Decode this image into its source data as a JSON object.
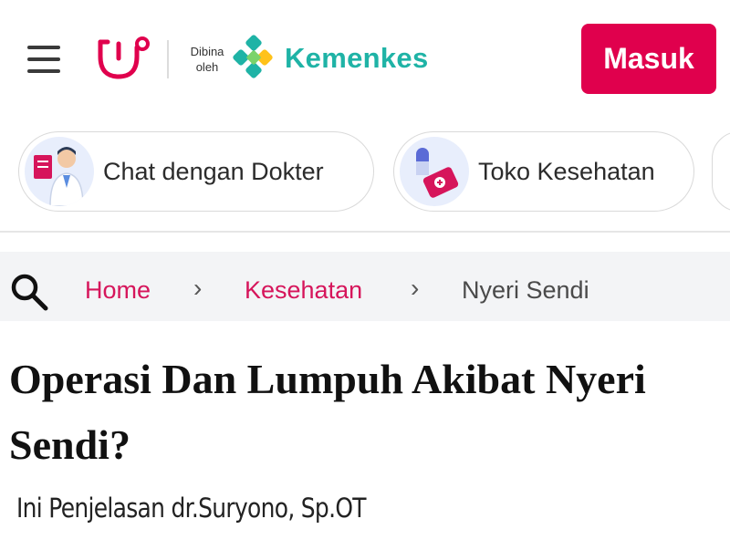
{
  "header": {
    "menu_icon": "hamburger-menu-icon",
    "brand_icon": "stethoscope-logo-icon",
    "partner_prefix_line1": "Dibina",
    "partner_prefix_line2": "oleh",
    "partner_name": "Kemenkes",
    "partner_icon": "kemenkes-logo-icon",
    "login_label": "Masuk",
    "colors": {
      "brand": "#e0004d",
      "partner": "#1fb3a6"
    }
  },
  "quick_actions": [
    {
      "label": "Chat dengan Dokter",
      "icon": "doctor-chat-icon"
    },
    {
      "label": "Toko Kesehatan",
      "icon": "pharmacy-store-icon"
    },
    {
      "label": "",
      "icon": "more-action-icon"
    }
  ],
  "breadcrumb": {
    "search_icon": "search-icon",
    "items": [
      "Home",
      "Kesehatan",
      "Nyeri Sendi"
    ],
    "separator_icon": "chevron-right-icon"
  },
  "article": {
    "title": "Operasi Dan Lumpuh Akibat Nyeri Sendi?",
    "subtitle": "Ini Penjelasan dr.Suryono, Sp.OT"
  }
}
